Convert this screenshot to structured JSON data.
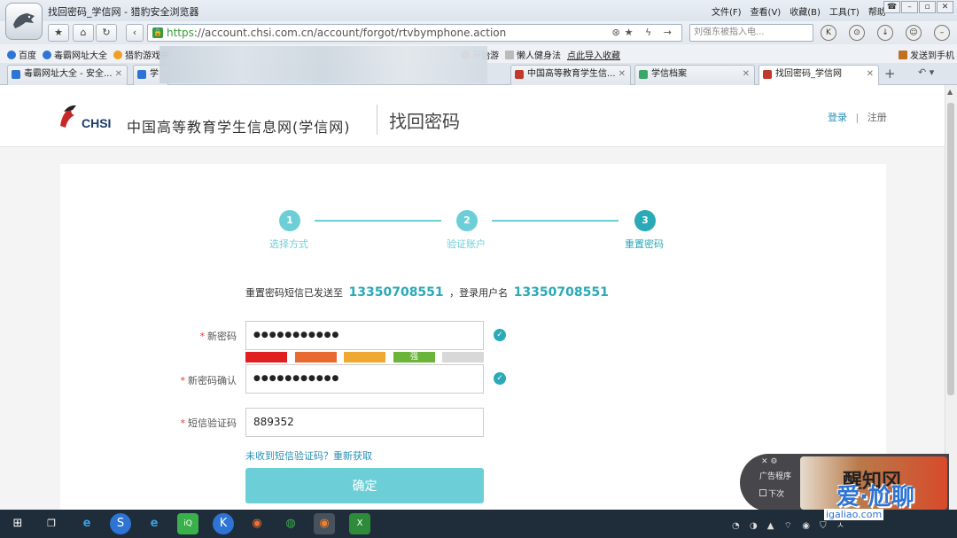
{
  "browser": {
    "window_title": "找回密码_学信网 - 猎豹安全浏览器",
    "menu": [
      "文件(F)",
      "查看(V)",
      "收藏(B)",
      "工具(T)",
      "帮助"
    ],
    "window_controls": [
      "☎",
      "–",
      "▫",
      "✕"
    ],
    "url_https": "https",
    "url_rest": "://account.chsi.com.cn/account/forgot/rtvbymphone.action",
    "address_icons": "⊛★ ϟ →",
    "search_placeholder": "刘强东被指入电...",
    "nav": {
      "back": "‹",
      "star": "★",
      "home": "⌂",
      "refresh": "↻"
    }
  },
  "bookmarks": [
    {
      "label": "百度",
      "color": "#2d74d4"
    },
    {
      "label": "毒霸网址大全",
      "color": "#2d74d4"
    },
    {
      "label": "猎豹游戏中",
      "color": "#f0a020"
    },
    {
      "label": "开始游",
      "color": "#f07030"
    },
    {
      "label": "懒人健身法",
      "color": "#bbbbbb"
    },
    {
      "label": "点此导入收藏",
      "color": "#ffffff"
    },
    {
      "label": "发送到手机",
      "color": "#c07020"
    }
  ],
  "tabs": [
    {
      "label": "毒霸网址大全 - 安全...",
      "color": "#2d74d4"
    },
    {
      "label": "学",
      "color": "#2d74d4"
    },
    {
      "label": "中国高等教育学生信...",
      "color": "#c0392b"
    },
    {
      "label": "学信档案",
      "color": "#3aa66a"
    },
    {
      "label": "找回密码_学信网",
      "color": "#c0392b"
    }
  ],
  "new_tab": "+",
  "site": {
    "logo_text": "CHSI",
    "name": "中国高等教育学生信息网(学信网)",
    "page_title": "找回密码",
    "login": "登录",
    "separator": "|",
    "register": "注册"
  },
  "steps": [
    {
      "num": "1",
      "label": "选择方式"
    },
    {
      "num": "2",
      "label": "验证账户"
    },
    {
      "num": "3",
      "label": "重置密码"
    }
  ],
  "info": {
    "prefix": "重置密码短信已发送至",
    "phone": "13350708551",
    "middle": "，登录用户名",
    "username": "13350708551"
  },
  "form": {
    "new_password_label": "新密码",
    "new_password_value": "●●●●●●●●●●●",
    "confirm_label": "新密码确认",
    "confirm_value": "●●●●●●●●●●●",
    "sms_label": "短信验证码",
    "sms_value": "889352",
    "required_mark": "*",
    "strength_label": "强",
    "strength_colors": [
      "#e02020",
      "#e86a30",
      "#f0a830",
      "#6ab43a",
      "#d8d8d8"
    ],
    "check": "✓",
    "resend": "未收到短信验证码？重新获取",
    "submit": "确定"
  },
  "ad": {
    "close": "✕ ⚙",
    "label": "广告程序",
    "option": "下次",
    "headline": "醒知冈"
  },
  "watermark": {
    "main": "爱·尬聊",
    "url": "igaliao.com"
  },
  "taskbar": {
    "start": "⊞",
    "tray_text": "◔ ◑ ▲ ⌔ ◉ ⛉ ㅅ"
  }
}
